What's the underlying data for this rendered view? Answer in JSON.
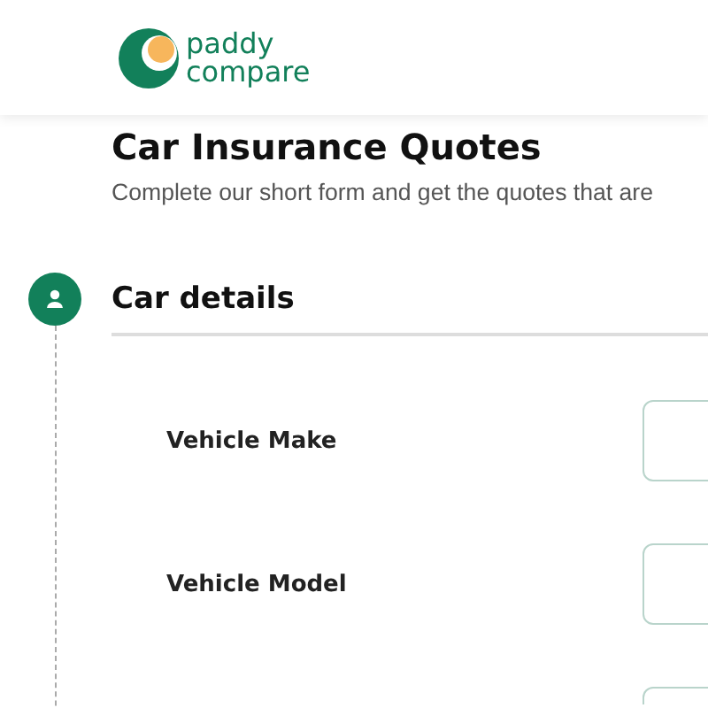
{
  "header": {
    "logo": {
      "line_1": "paddy",
      "line_2": "compare"
    }
  },
  "page": {
    "title": "Car Insurance Quotes",
    "subtitle": "Complete our short form and get the quotes that are"
  },
  "steps": [
    {
      "title": "Car details",
      "fields": [
        {
          "kind": "text_input",
          "label": "Vehicle Make"
        },
        {
          "kind": "text_input",
          "label": "Vehicle Model"
        },
        {
          "kind": "text_input"
        }
      ]
    }
  ]
}
